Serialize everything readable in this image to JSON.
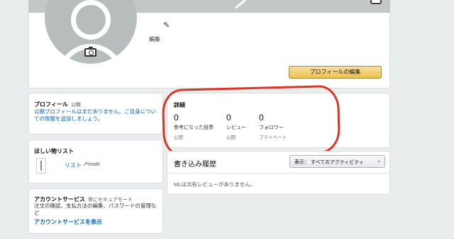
{
  "profile": {
    "edit_label": "編集",
    "edit_profile_button": "プロフィールの編集"
  },
  "public_profile": {
    "title": "プロフィール",
    "status": "公開",
    "message": "公開プロフィールはまだありません。ご自身についての情報を追加しましょう。"
  },
  "wishlist": {
    "title": "ほしい物リスト",
    "list_name": "リスト",
    "privacy": "Private"
  },
  "account": {
    "title": "アカウントサービス",
    "mode": "常にセキュアモード",
    "description": "注文の確認、支払方法の編集、パスワードの管理など",
    "link": "アカウントサービスを表示"
  },
  "details": {
    "title": "詳細",
    "stats": [
      {
        "value": "0",
        "label": "参考になった投票",
        "sub": "公開"
      },
      {
        "value": "0",
        "label": "レビュー",
        "sub": "公開"
      },
      {
        "value": "0",
        "label": "フォロワー",
        "sub": "プライベート"
      }
    ]
  },
  "activity": {
    "title": "書き込み履歴",
    "filter_label": "表示：",
    "filter_value": "すべてのアクティビティ",
    "empty_message": "MLは共有レビューがありません。"
  },
  "colors": {
    "annotation": "#d9362a",
    "link": "#0066c0",
    "button": "#f0c14b"
  }
}
